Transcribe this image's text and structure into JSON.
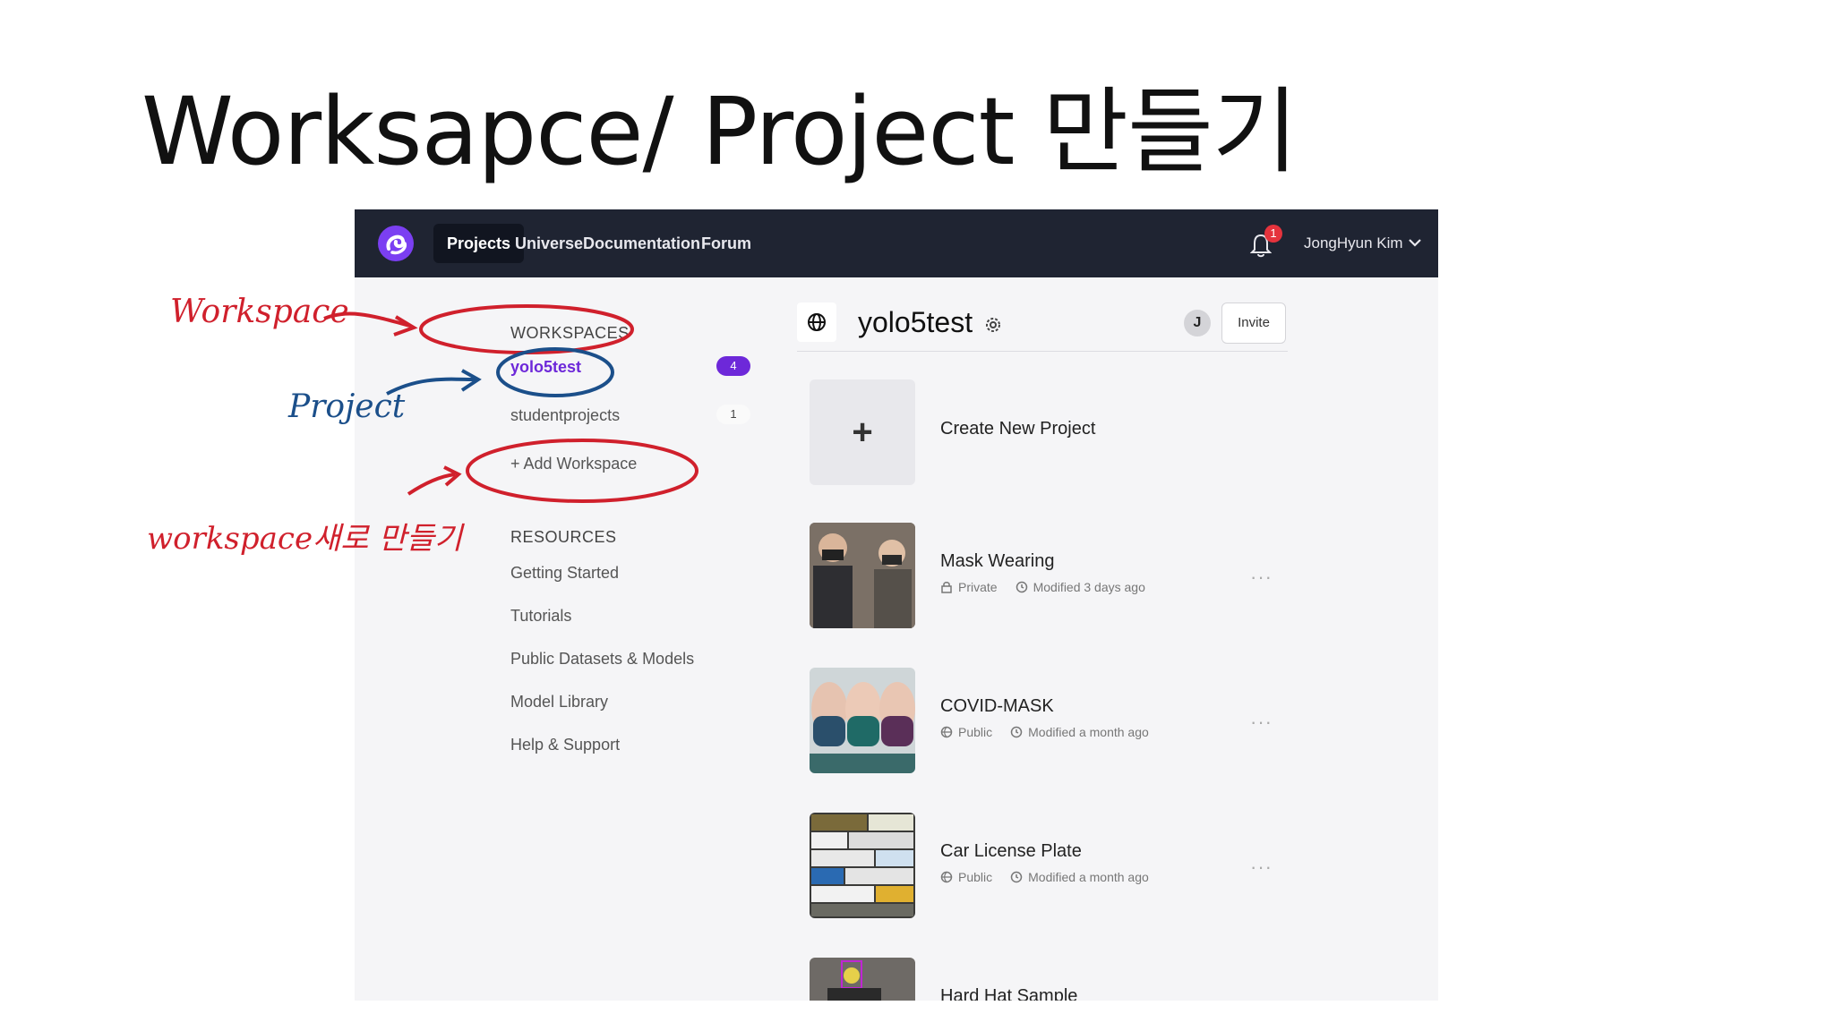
{
  "slide": {
    "title": "Worksapce/ Project 만들기"
  },
  "navbar": {
    "items": [
      {
        "label": "Projects",
        "active": true
      },
      {
        "label": "Universe"
      },
      {
        "label": "Documentation"
      },
      {
        "label": "Forum"
      }
    ],
    "notification_count": "1",
    "user_name": "JongHyun Kim"
  },
  "sidebar": {
    "workspaces_heading": "WORKSPACES",
    "workspaces": [
      {
        "name": "yolo5test",
        "count": "4"
      },
      {
        "name": "studentprojects",
        "count": "1"
      }
    ],
    "add_workspace": "+ Add Workspace",
    "resources_heading": "RESOURCES",
    "resources": [
      "Getting Started",
      "Tutorials",
      "Public Datasets & Models",
      "Model Library",
      "Help & Support"
    ]
  },
  "workspace": {
    "title": "yolo5test",
    "avatar_initial": "J",
    "invite_label": "Invite",
    "create_label": "Create New Project",
    "projects": [
      {
        "name": "Mask Wearing",
        "visibility": "Private",
        "modified": "Modified 3 days ago"
      },
      {
        "name": "COVID-MASK",
        "visibility": "Public",
        "modified": "Modified a month ago"
      },
      {
        "name": "Car License Plate",
        "visibility": "Public",
        "modified": "Modified a month ago"
      },
      {
        "name": "Hard Hat Sample",
        "visibility": "",
        "modified": ""
      }
    ],
    "more_label": "···"
  },
  "annotations": {
    "workspace_label": "Workspace",
    "project_label": "Project",
    "new_workspace_label": "workspace새로 만들기",
    "ink_red": "#d0202c",
    "ink_blue": "#1b4f8a"
  },
  "colors": {
    "nav_bg": "#1f2432",
    "accent": "#6d28d9",
    "page_bg": "#f5f5f7"
  }
}
